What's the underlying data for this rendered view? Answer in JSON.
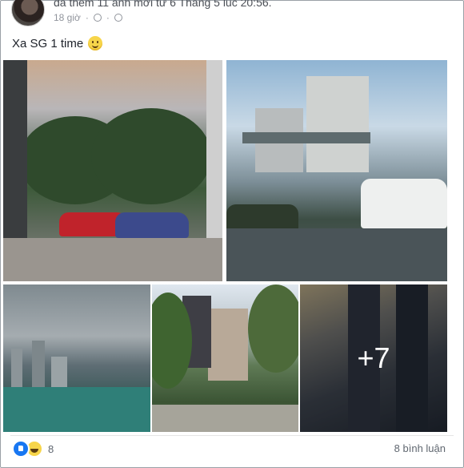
{
  "post": {
    "header_text": "đã thêm 11 ảnh mới từ 6 Tháng 5 lúc 20:56.",
    "timestamp": "18 giờ",
    "privacy_icon": "globe-icon",
    "text": "Xa SG 1 time",
    "emoji": "smile-emoji-icon"
  },
  "photos": {
    "more_count": "+7"
  },
  "footer": {
    "reactions": [
      "like-reaction-icon",
      "haha-reaction-icon"
    ],
    "reaction_count": "8",
    "comments_label": "8 bình luận"
  }
}
